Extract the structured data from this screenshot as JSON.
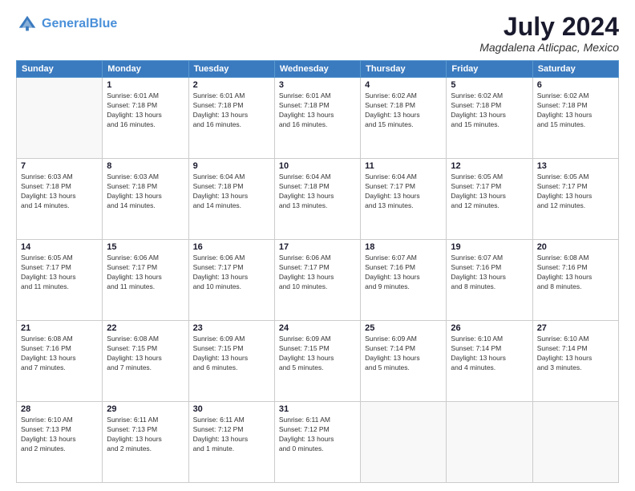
{
  "header": {
    "logo_line1": "General",
    "logo_line2": "Blue",
    "month_year": "July 2024",
    "location": "Magdalena Atlicpac, Mexico"
  },
  "calendar": {
    "days_of_week": [
      "Sunday",
      "Monday",
      "Tuesday",
      "Wednesday",
      "Thursday",
      "Friday",
      "Saturday"
    ],
    "weeks": [
      [
        {
          "day": "",
          "info": ""
        },
        {
          "day": "1",
          "info": "Sunrise: 6:01 AM\nSunset: 7:18 PM\nDaylight: 13 hours\nand 16 minutes."
        },
        {
          "day": "2",
          "info": "Sunrise: 6:01 AM\nSunset: 7:18 PM\nDaylight: 13 hours\nand 16 minutes."
        },
        {
          "day": "3",
          "info": "Sunrise: 6:01 AM\nSunset: 7:18 PM\nDaylight: 13 hours\nand 16 minutes."
        },
        {
          "day": "4",
          "info": "Sunrise: 6:02 AM\nSunset: 7:18 PM\nDaylight: 13 hours\nand 15 minutes."
        },
        {
          "day": "5",
          "info": "Sunrise: 6:02 AM\nSunset: 7:18 PM\nDaylight: 13 hours\nand 15 minutes."
        },
        {
          "day": "6",
          "info": "Sunrise: 6:02 AM\nSunset: 7:18 PM\nDaylight: 13 hours\nand 15 minutes."
        }
      ],
      [
        {
          "day": "7",
          "info": "Sunrise: 6:03 AM\nSunset: 7:18 PM\nDaylight: 13 hours\nand 14 minutes."
        },
        {
          "day": "8",
          "info": "Sunrise: 6:03 AM\nSunset: 7:18 PM\nDaylight: 13 hours\nand 14 minutes."
        },
        {
          "day": "9",
          "info": "Sunrise: 6:04 AM\nSunset: 7:18 PM\nDaylight: 13 hours\nand 14 minutes."
        },
        {
          "day": "10",
          "info": "Sunrise: 6:04 AM\nSunset: 7:18 PM\nDaylight: 13 hours\nand 13 minutes."
        },
        {
          "day": "11",
          "info": "Sunrise: 6:04 AM\nSunset: 7:17 PM\nDaylight: 13 hours\nand 13 minutes."
        },
        {
          "day": "12",
          "info": "Sunrise: 6:05 AM\nSunset: 7:17 PM\nDaylight: 13 hours\nand 12 minutes."
        },
        {
          "day": "13",
          "info": "Sunrise: 6:05 AM\nSunset: 7:17 PM\nDaylight: 13 hours\nand 12 minutes."
        }
      ],
      [
        {
          "day": "14",
          "info": "Sunrise: 6:05 AM\nSunset: 7:17 PM\nDaylight: 13 hours\nand 11 minutes."
        },
        {
          "day": "15",
          "info": "Sunrise: 6:06 AM\nSunset: 7:17 PM\nDaylight: 13 hours\nand 11 minutes."
        },
        {
          "day": "16",
          "info": "Sunrise: 6:06 AM\nSunset: 7:17 PM\nDaylight: 13 hours\nand 10 minutes."
        },
        {
          "day": "17",
          "info": "Sunrise: 6:06 AM\nSunset: 7:17 PM\nDaylight: 13 hours\nand 10 minutes."
        },
        {
          "day": "18",
          "info": "Sunrise: 6:07 AM\nSunset: 7:16 PM\nDaylight: 13 hours\nand 9 minutes."
        },
        {
          "day": "19",
          "info": "Sunrise: 6:07 AM\nSunset: 7:16 PM\nDaylight: 13 hours\nand 8 minutes."
        },
        {
          "day": "20",
          "info": "Sunrise: 6:08 AM\nSunset: 7:16 PM\nDaylight: 13 hours\nand 8 minutes."
        }
      ],
      [
        {
          "day": "21",
          "info": "Sunrise: 6:08 AM\nSunset: 7:16 PM\nDaylight: 13 hours\nand 7 minutes."
        },
        {
          "day": "22",
          "info": "Sunrise: 6:08 AM\nSunset: 7:15 PM\nDaylight: 13 hours\nand 7 minutes."
        },
        {
          "day": "23",
          "info": "Sunrise: 6:09 AM\nSunset: 7:15 PM\nDaylight: 13 hours\nand 6 minutes."
        },
        {
          "day": "24",
          "info": "Sunrise: 6:09 AM\nSunset: 7:15 PM\nDaylight: 13 hours\nand 5 minutes."
        },
        {
          "day": "25",
          "info": "Sunrise: 6:09 AM\nSunset: 7:14 PM\nDaylight: 13 hours\nand 5 minutes."
        },
        {
          "day": "26",
          "info": "Sunrise: 6:10 AM\nSunset: 7:14 PM\nDaylight: 13 hours\nand 4 minutes."
        },
        {
          "day": "27",
          "info": "Sunrise: 6:10 AM\nSunset: 7:14 PM\nDaylight: 13 hours\nand 3 minutes."
        }
      ],
      [
        {
          "day": "28",
          "info": "Sunrise: 6:10 AM\nSunset: 7:13 PM\nDaylight: 13 hours\nand 2 minutes."
        },
        {
          "day": "29",
          "info": "Sunrise: 6:11 AM\nSunset: 7:13 PM\nDaylight: 13 hours\nand 2 minutes."
        },
        {
          "day": "30",
          "info": "Sunrise: 6:11 AM\nSunset: 7:12 PM\nDaylight: 13 hours\nand 1 minute."
        },
        {
          "day": "31",
          "info": "Sunrise: 6:11 AM\nSunset: 7:12 PM\nDaylight: 13 hours\nand 0 minutes."
        },
        {
          "day": "",
          "info": ""
        },
        {
          "day": "",
          "info": ""
        },
        {
          "day": "",
          "info": ""
        }
      ]
    ]
  }
}
